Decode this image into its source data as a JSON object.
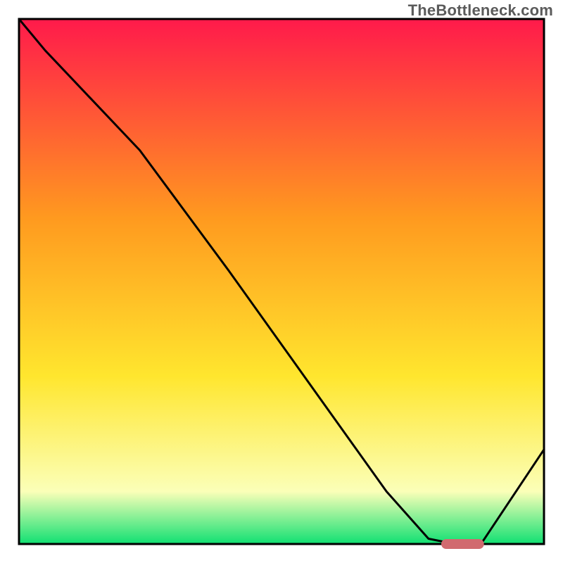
{
  "attribution": "TheBottleneck.com",
  "colors": {
    "gradient_top": "#ff1a4b",
    "gradient_orange": "#ff9a1f",
    "gradient_yellow": "#ffe62e",
    "gradient_pale": "#fbffb8",
    "gradient_green": "#10e072",
    "frame_stroke": "#000000",
    "curve_stroke": "#000000",
    "marker_fill": "#d16a6f",
    "marker_stroke": "#d16a6f"
  },
  "chart_data": {
    "type": "line",
    "title": "",
    "xlabel": "",
    "ylabel": "",
    "x": [
      0.0,
      0.05,
      0.23,
      0.4,
      0.55,
      0.7,
      0.78,
      0.83,
      0.88,
      1.0
    ],
    "values": [
      1.0,
      0.94,
      0.75,
      0.52,
      0.31,
      0.1,
      0.01,
      0.0,
      0.0,
      0.18
    ],
    "xlim": [
      0,
      1
    ],
    "ylim": [
      0,
      1
    ],
    "marker": {
      "x_start": 0.805,
      "x_end": 0.885,
      "y": 0.0
    },
    "notes": "x is a normalized horizontal position across the plot frame; y is a normalized bottleneck/mismatch score where 0 (bottom, green) is optimal and 1 (top, red) is worst. Values estimated from pixel positions; no axis ticks or numeric labels are shown in the source image."
  }
}
